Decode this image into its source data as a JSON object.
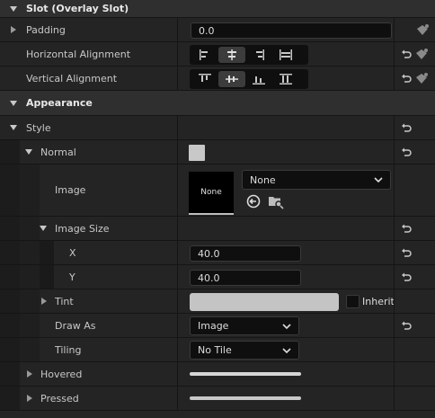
{
  "sections": {
    "slot": {
      "title": "Slot (Overlay Slot)"
    },
    "appearance": {
      "title": "Appearance"
    }
  },
  "padding": {
    "label": "Padding",
    "value": "0.0"
  },
  "horizontal_alignment": {
    "label": "Horizontal Alignment",
    "selected_index": 1
  },
  "vertical_alignment": {
    "label": "Vertical Alignment",
    "selected_index": 1
  },
  "style": {
    "label": "Style"
  },
  "normal": {
    "label": "Normal",
    "swatch_color": "#c8c8c8"
  },
  "image": {
    "label": "Image",
    "thumbnail_text": "None",
    "asset_value": "None"
  },
  "image_size": {
    "label": "Image Size",
    "x_label": "X",
    "x_value": "40.0",
    "y_label": "Y",
    "y_value": "40.0"
  },
  "tint": {
    "label": "Tint",
    "color": "#c4c4c4",
    "inherit_label": "Inherit"
  },
  "draw_as": {
    "label": "Draw As",
    "value": "Image"
  },
  "tiling": {
    "label": "Tiling",
    "value": "No Tile"
  },
  "hovered": {
    "label": "Hovered"
  },
  "pressed": {
    "label": "Pressed"
  }
}
